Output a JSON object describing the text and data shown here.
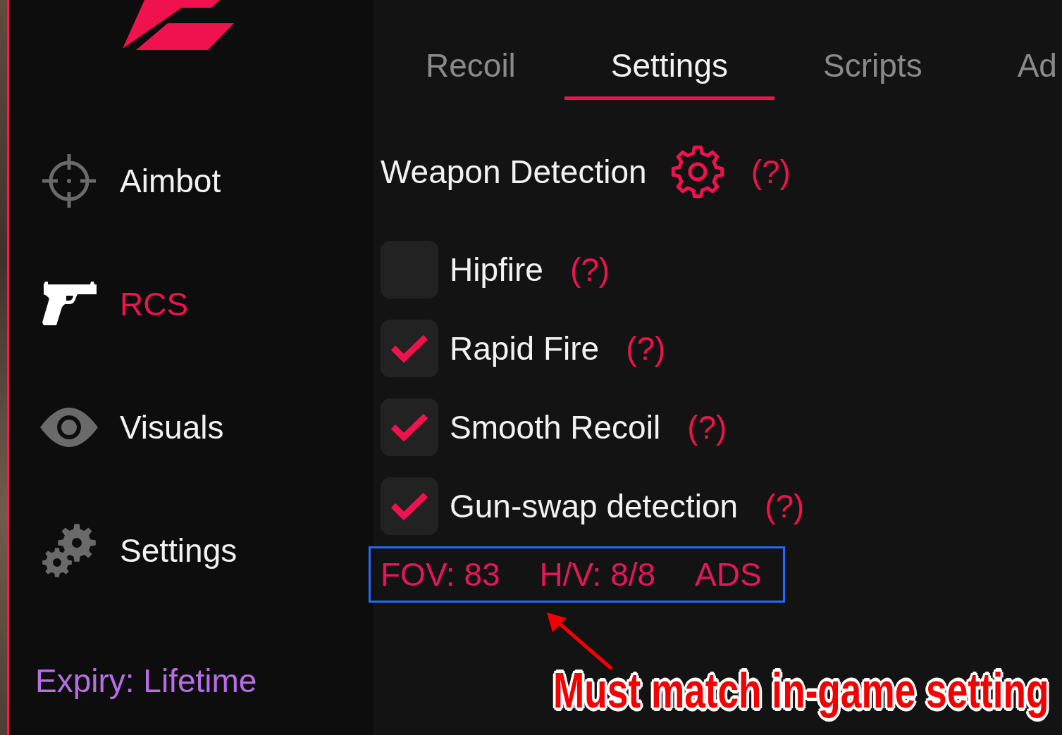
{
  "sidebar": {
    "items": [
      {
        "label": "Aimbot",
        "selected": false
      },
      {
        "label": "RCS",
        "selected": true
      },
      {
        "label": "Visuals",
        "selected": false
      },
      {
        "label": "Settings",
        "selected": false
      }
    ],
    "expiry": "Expiry: Lifetime"
  },
  "tabs": [
    {
      "label": "Recoil",
      "selected": false
    },
    {
      "label": "Settings",
      "selected": true
    },
    {
      "label": "Scripts",
      "selected": false
    },
    {
      "label": "Ad",
      "selected": false
    }
  ],
  "section": {
    "title": "Weapon Detection",
    "help": "(?)"
  },
  "options": [
    {
      "label": "Hipfire",
      "help": "(?)",
      "checked": false
    },
    {
      "label": "Rapid Fire",
      "help": "(?)",
      "checked": true
    },
    {
      "label": "Smooth Recoil",
      "help": "(?)",
      "checked": true
    },
    {
      "label": "Gun-swap detection",
      "help": "(?)",
      "checked": true
    }
  ],
  "stats": {
    "highlighted": true,
    "items": [
      "FOV: 83",
      "H/V: 8/8",
      "ADS"
    ]
  },
  "annotation": {
    "text": "Must match in-game setting"
  }
}
